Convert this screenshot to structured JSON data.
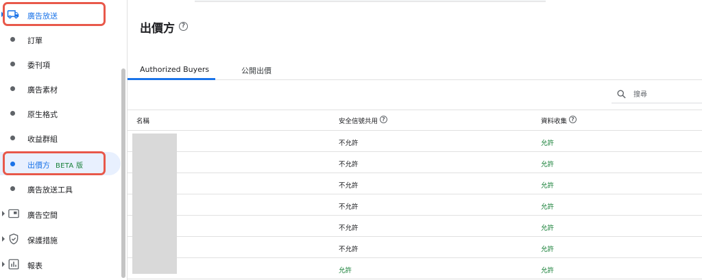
{
  "sidebar": {
    "top": {
      "label": "廣告放送"
    },
    "items": [
      {
        "label": "訂單"
      },
      {
        "label": "委刊項"
      },
      {
        "label": "廣告素材"
      },
      {
        "label": "原生格式"
      },
      {
        "label": "收益群組"
      },
      {
        "label": "出價方",
        "badge": "BETA 版"
      },
      {
        "label": "廣告放送工具"
      }
    ],
    "sections": [
      {
        "label": "廣告空間",
        "icon": "ad-space-icon"
      },
      {
        "label": "保護措施",
        "icon": "shield-icon"
      },
      {
        "label": "報表",
        "icon": "bar-chart-icon"
      }
    ]
  },
  "main": {
    "title": "出價方",
    "tabs": [
      {
        "label": "Authorized Buyers"
      },
      {
        "label": "公開出價"
      }
    ],
    "search": {
      "placeholder": "搜尋"
    },
    "table": {
      "columns": [
        "名稱",
        "安全信號共用",
        "資料收集"
      ],
      "rows": [
        {
          "signal": "不允許",
          "collect": "允許"
        },
        {
          "signal": "不允許",
          "collect": "允許"
        },
        {
          "signal": "不允許",
          "collect": "允許"
        },
        {
          "signal": "不允許",
          "collect": "允許"
        },
        {
          "signal": "不允許",
          "collect": "允許"
        },
        {
          "signal": "不允許",
          "collect": "允許"
        },
        {
          "signal": "允許",
          "collect": "允許"
        }
      ]
    }
  },
  "colors": {
    "accent": "#1a73e8",
    "allow": "#188038",
    "highlight": "#e8584a"
  }
}
